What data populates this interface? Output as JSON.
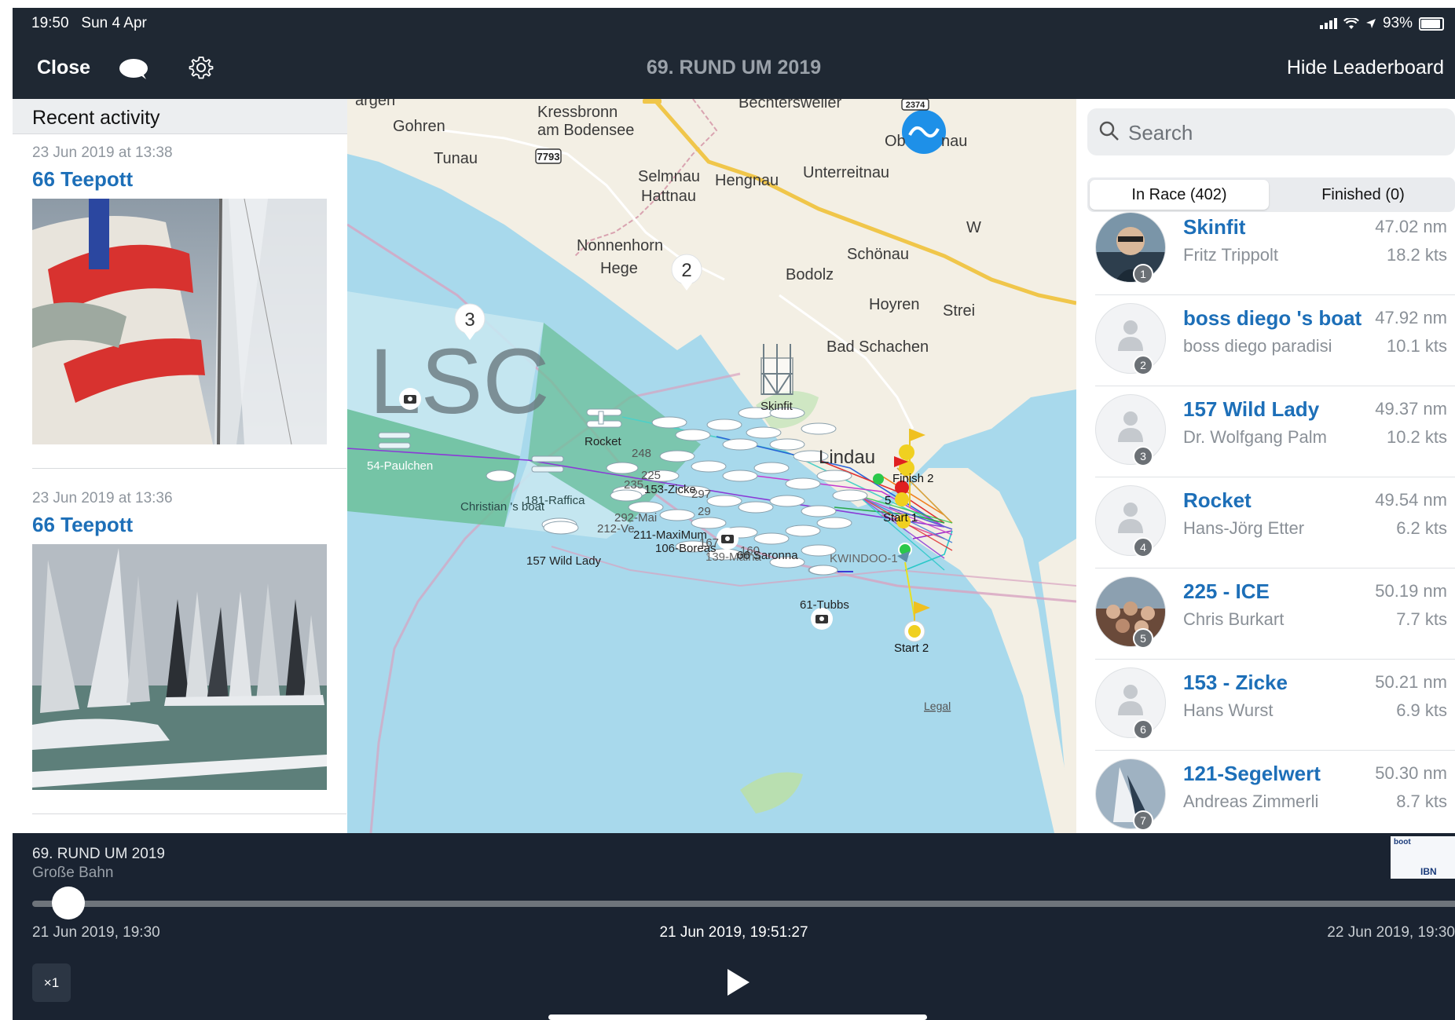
{
  "status_bar": {
    "time": "19:50",
    "date": "Sun 4 Apr",
    "battery": "93%"
  },
  "nav": {
    "close_label": "Close",
    "title": "69. RUND UM 2019",
    "hide_leaderboard_label": "Hide Leaderboard"
  },
  "activity": {
    "header": "Recent activity",
    "items": [
      {
        "date": "23 Jun 2019 at 13:38",
        "name": "66 Teepott"
      },
      {
        "date": "23 Jun 2019 at 13:36",
        "name": "66 Teepott"
      }
    ]
  },
  "map": {
    "places": [
      "argen",
      "Gohren",
      "Kressbronn",
      "am Bodensee",
      "Tunau",
      "Bechtersweiler",
      "Ob",
      "nau",
      "Selmnau",
      "Hengnau",
      "Unterreitnau",
      "Hattnau",
      "Nonnenhorn",
      "Hege",
      "Schönau",
      "Bodolz",
      "Hoyren",
      "Strei",
      "Bad Schachen",
      "Lindau",
      "W"
    ],
    "road_labels": [
      "7793",
      "2374"
    ],
    "cluster_counts": [
      "2",
      "3"
    ],
    "boats": [
      "Rocket",
      "54-Paulchen",
      "Christian 's boat",
      "181-Raffica",
      "292-Mai",
      "212-Ve",
      "211-MaxiMum",
      "106-Boreas",
      "157 Wild Lady",
      "61-Tubbs",
      "KWINDOO-1",
      "139-Malha",
      "248",
      "225",
      "235",
      "153-Zicke",
      "297",
      "29",
      "160",
      "167",
      "66 Saronna",
      "Skinfit"
    ],
    "marks": [
      "Start 1",
      "Start 2",
      "Finish 2",
      "5"
    ],
    "logo_text": "LSC",
    "legal": "Legal"
  },
  "leaderboard": {
    "search_placeholder": "Search",
    "tabs": [
      "In Race (402)",
      "Finished (0)"
    ],
    "entries": [
      {
        "rank": "1",
        "name": "Skinfit",
        "skipper": "Fritz Trippolt",
        "distance": "47.02 nm",
        "speed": "18.2 kts",
        "photo": true
      },
      {
        "rank": "2",
        "name": "boss diego 's boat",
        "skipper": "boss diego  paradisi",
        "distance": "47.92 nm",
        "speed": "10.1 kts",
        "photo": false
      },
      {
        "rank": "3",
        "name": "157 Wild Lady",
        "skipper": "Dr. Wolfgang Palm",
        "distance": "49.37 nm",
        "speed": "10.2 kts",
        "photo": false
      },
      {
        "rank": "4",
        "name": "Rocket",
        "skipper": "Hans-Jörg Etter",
        "distance": "49.54 nm",
        "speed": "6.2 kts",
        "photo": false
      },
      {
        "rank": "5",
        "name": "225 - ICE",
        "skipper": "Chris Burkart",
        "distance": "50.19 nm",
        "speed": "7.7 kts",
        "photo": true
      },
      {
        "rank": "6",
        "name": "153 - Zicke",
        "skipper": "Hans Wurst",
        "distance": "50.21 nm",
        "speed": "6.9 kts",
        "photo": false
      },
      {
        "rank": "7",
        "name": "121-Segelwert",
        "skipper": "Andreas Zimmerli",
        "distance": "50.30 nm",
        "speed": "8.7 kts",
        "photo": true
      }
    ]
  },
  "player": {
    "race_title": "69. RUND UM 2019",
    "course": "Große Bahn",
    "start_time": "21 Jun 2019, 19:30",
    "current_time": "21 Jun 2019, 19:51:27",
    "end_time": "22 Jun 2019, 19:30",
    "speed_label": "×1",
    "progress": 0.014,
    "sponsor": [
      "boot",
      "IBN"
    ]
  },
  "colors": {
    "bar_bg": "#1f2833",
    "accent_blue": "#1d6fb8",
    "water": "#a8d9ec",
    "land": "#f3efe4",
    "course_green": "#6cbf9a",
    "fab_blue": "#1e90e8"
  }
}
